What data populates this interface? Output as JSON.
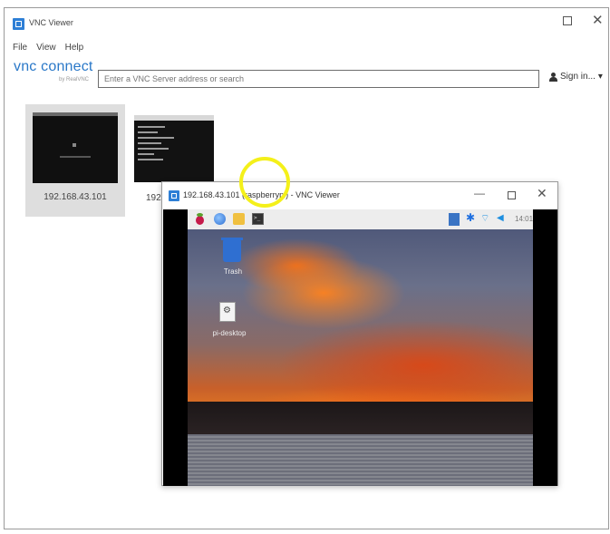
{
  "main_window": {
    "title": "VNC Viewer",
    "app_icon": "vnc-viewer-icon",
    "maximize_icon": "maximize-icon",
    "close_icon": "close-icon",
    "close_glyph": "✕"
  },
  "menu": {
    "items": [
      "File",
      "View",
      "Help"
    ]
  },
  "logo": {
    "text": "vnc connect",
    "subtext": "by RealVNC"
  },
  "search": {
    "placeholder": "Enter a VNC Server address or search"
  },
  "account": {
    "icon": "user-icon",
    "label": "Sign in...",
    "chevron": "▾"
  },
  "connections": [
    {
      "label": "192.168.43.101"
    },
    {
      "label": "192."
    }
  ],
  "remote_window": {
    "title": "192.168.43.101 (raspberrypi) - VNC Viewer",
    "minimize_glyph": "—",
    "close_glyph": "✕",
    "taskbar": {
      "icons": [
        "raspberry-icon",
        "browser-icon",
        "folder-icon",
        "terminal-icon",
        "vnc-icon",
        "bluetooth-icon",
        "wifi-icon",
        "volume-icon"
      ],
      "bluetooth_glyph": "✱",
      "wifi_glyph": "⌔",
      "volume_glyph": "◀",
      "clock": "14:01"
    },
    "desktop": {
      "trash_label": "Trash",
      "file_label": "pi-desktop"
    }
  },
  "colors": {
    "accent": "#2e7fd6",
    "highlight": "#f4f01a"
  }
}
